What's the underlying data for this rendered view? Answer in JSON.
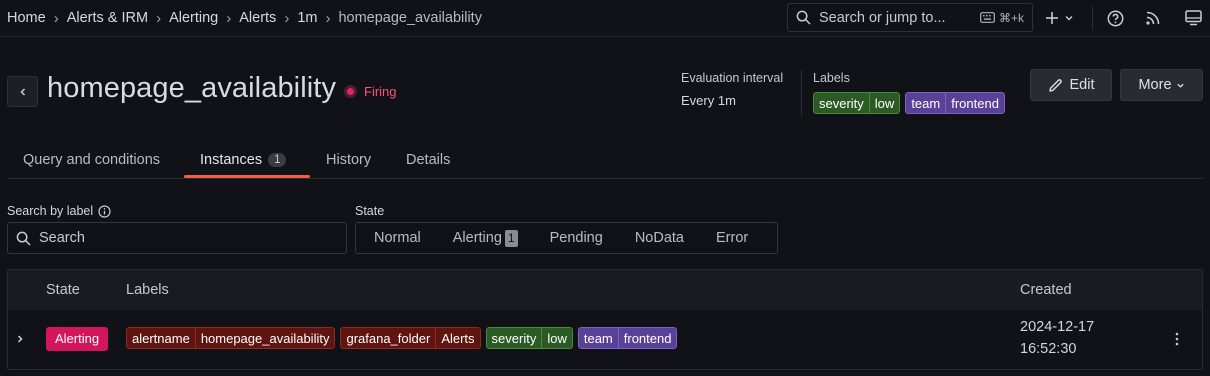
{
  "breadcrumbs": [
    "Home",
    "Alerts & IRM",
    "Alerting",
    "Alerts",
    "1m",
    "homepage_availability"
  ],
  "top_search": {
    "placeholder": "Search or jump to...",
    "shortcut": "⌘+k"
  },
  "header": {
    "title": "homepage_availability",
    "status": "Firing",
    "evaluation_interval_label": "Evaluation interval",
    "evaluation_interval_value": "Every 1m",
    "labels_title": "Labels",
    "labels": [
      {
        "key": "severity",
        "value": "low",
        "color": "#2c5a24"
      },
      {
        "key": "team",
        "value": "frontend",
        "color": "#5a4198"
      }
    ],
    "edit_label": "Edit",
    "more_label": "More"
  },
  "tabs": [
    {
      "label": "Query and conditions"
    },
    {
      "label": "Instances",
      "count": "1",
      "active": true
    },
    {
      "label": "History"
    },
    {
      "label": "Details"
    }
  ],
  "filters": {
    "search_label": "Search by label",
    "search_placeholder": "Search",
    "state_label": "State",
    "states": [
      {
        "label": "Normal"
      },
      {
        "label": "Alerting",
        "count": "1"
      },
      {
        "label": "Pending"
      },
      {
        "label": "NoData"
      },
      {
        "label": "Error"
      }
    ]
  },
  "table": {
    "columns": {
      "state": "State",
      "labels": "Labels",
      "created": "Created"
    },
    "rows": [
      {
        "state": "Alerting",
        "labels": [
          {
            "key": "alertname",
            "value": "homepage_availability"
          },
          {
            "key": "grafana_folder",
            "value": "Alerts"
          },
          {
            "key": "severity",
            "value": "low"
          },
          {
            "key": "team",
            "value": "frontend"
          }
        ],
        "created_date": "2024-12-17",
        "created_time": "16:52:30"
      }
    ]
  },
  "colors": {
    "accent_tab": "#f55f3e",
    "firing": "#e0226e",
    "alerting_badge": "#d1165b"
  },
  "icons": [
    "chevron-left-icon",
    "search-icon",
    "keyboard-icon",
    "plus-icon",
    "help-icon",
    "rss-icon",
    "kiosk-icon",
    "pen-icon",
    "chevron-down-icon",
    "info-icon",
    "chevron-right-icon",
    "kebab-icon"
  ]
}
